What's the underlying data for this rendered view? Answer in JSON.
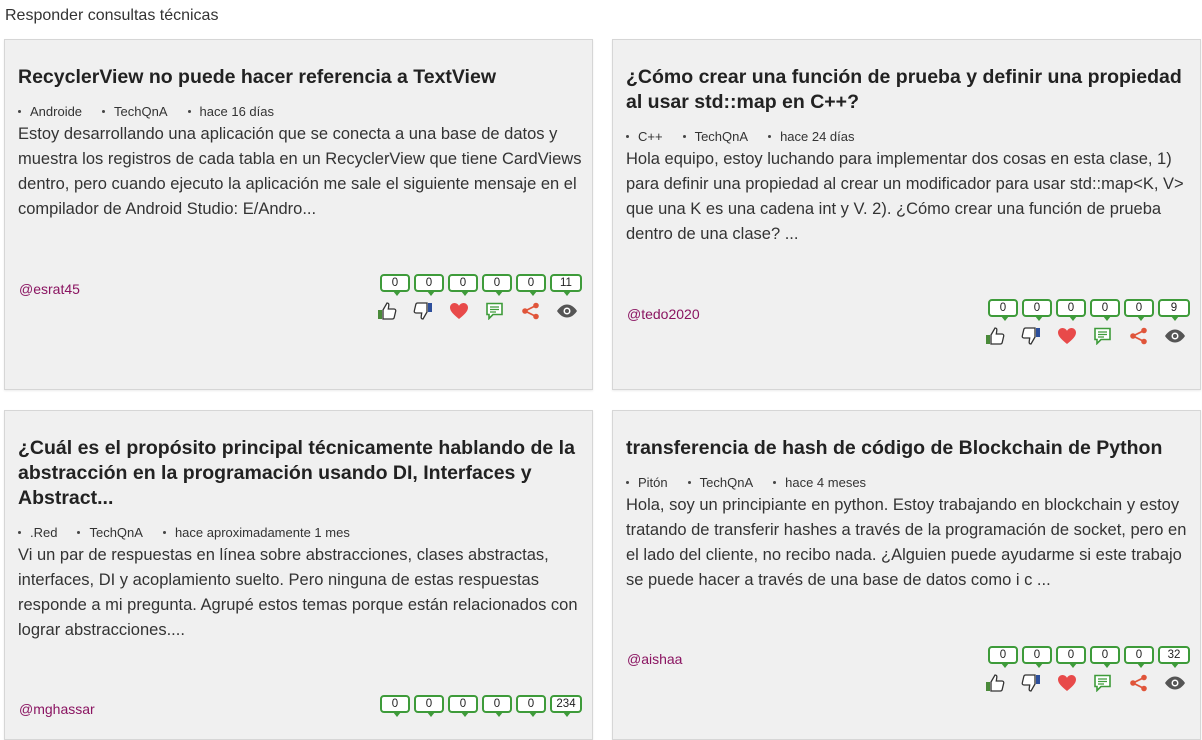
{
  "page": {
    "title": "Responder consultas técnicas"
  },
  "icons": [
    "thumbs-up-icon",
    "thumbs-down-icon",
    "heart-icon",
    "comment-icon",
    "share-icon",
    "eye-icon"
  ],
  "colors": {
    "author": "#8a1461",
    "badge_border": "#3e9b3a",
    "heart": "#e84a4a",
    "share": "#e0553a",
    "thumb_down": "#2d4f9b"
  },
  "cards": [
    {
      "title": "RecyclerView no puede hacer referencia a TextView",
      "tags": [
        "Androide",
        "TechQnA",
        "hace 16 días"
      ],
      "excerpt": "Estoy desarrollando una aplicación que se conecta a una base de datos y muestra los registros de cada tabla en un RecyclerView que tiene CardViews dentro, pero cuando ejecuto la aplicación me sale el siguiente mensaje en el compilador de Android Studio: E/Andro...",
      "author": "@esrat45",
      "counts": [
        "0",
        "0",
        "0",
        "0",
        "0",
        "11"
      ]
    },
    {
      "title": "¿Cómo crear una función de prueba y definir una propiedad al usar std::map en C++?",
      "tags": [
        "C++",
        "TechQnA",
        "hace 24 días"
      ],
      "excerpt": "Hola equipo, estoy luchando para implementar dos cosas en esta clase, 1) para definir una propiedad al crear un modificador para usar std::map<K, V> que una K es una cadena int y V. 2). ¿Cómo crear una función de prueba dentro de una clase? ...",
      "author": "@tedo2020",
      "counts": [
        "0",
        "0",
        "0",
        "0",
        "0",
        "9"
      ]
    },
    {
      "title": "¿Cuál es el propósito principal técnicamente hablando de la abstracción en la programación usando DI, Interfaces y Abstract...",
      "tags": [
        ".Red",
        "TechQnA",
        "hace aproximadamente 1 mes"
      ],
      "excerpt": "Vi un par de respuestas en línea sobre abstracciones, clases abstractas, interfaces, DI y acoplamiento suelto. Pero ninguna de estas respuestas responde a mi pregunta. Agrupé estos temas porque están relacionados con lograr abstracciones....",
      "author": "@mghassar",
      "counts": [
        "0",
        "0",
        "0",
        "0",
        "0",
        "234"
      ]
    },
    {
      "title": "transferencia de hash de código de Blockchain de Python",
      "tags": [
        "Pitón",
        "TechQnA",
        "hace 4 meses"
      ],
      "excerpt": "Hola, soy un principiante en python. Estoy trabajando en blockchain y estoy tratando de transferir hashes a través de la programación de socket, pero en el lado del cliente, no recibo nada. ¿Alguien puede ayudarme si este trabajo se puede hacer a través de una base de datos como i c ...",
      "author": "@aishaa",
      "counts": [
        "0",
        "0",
        "0",
        "0",
        "0",
        "32"
      ]
    }
  ]
}
